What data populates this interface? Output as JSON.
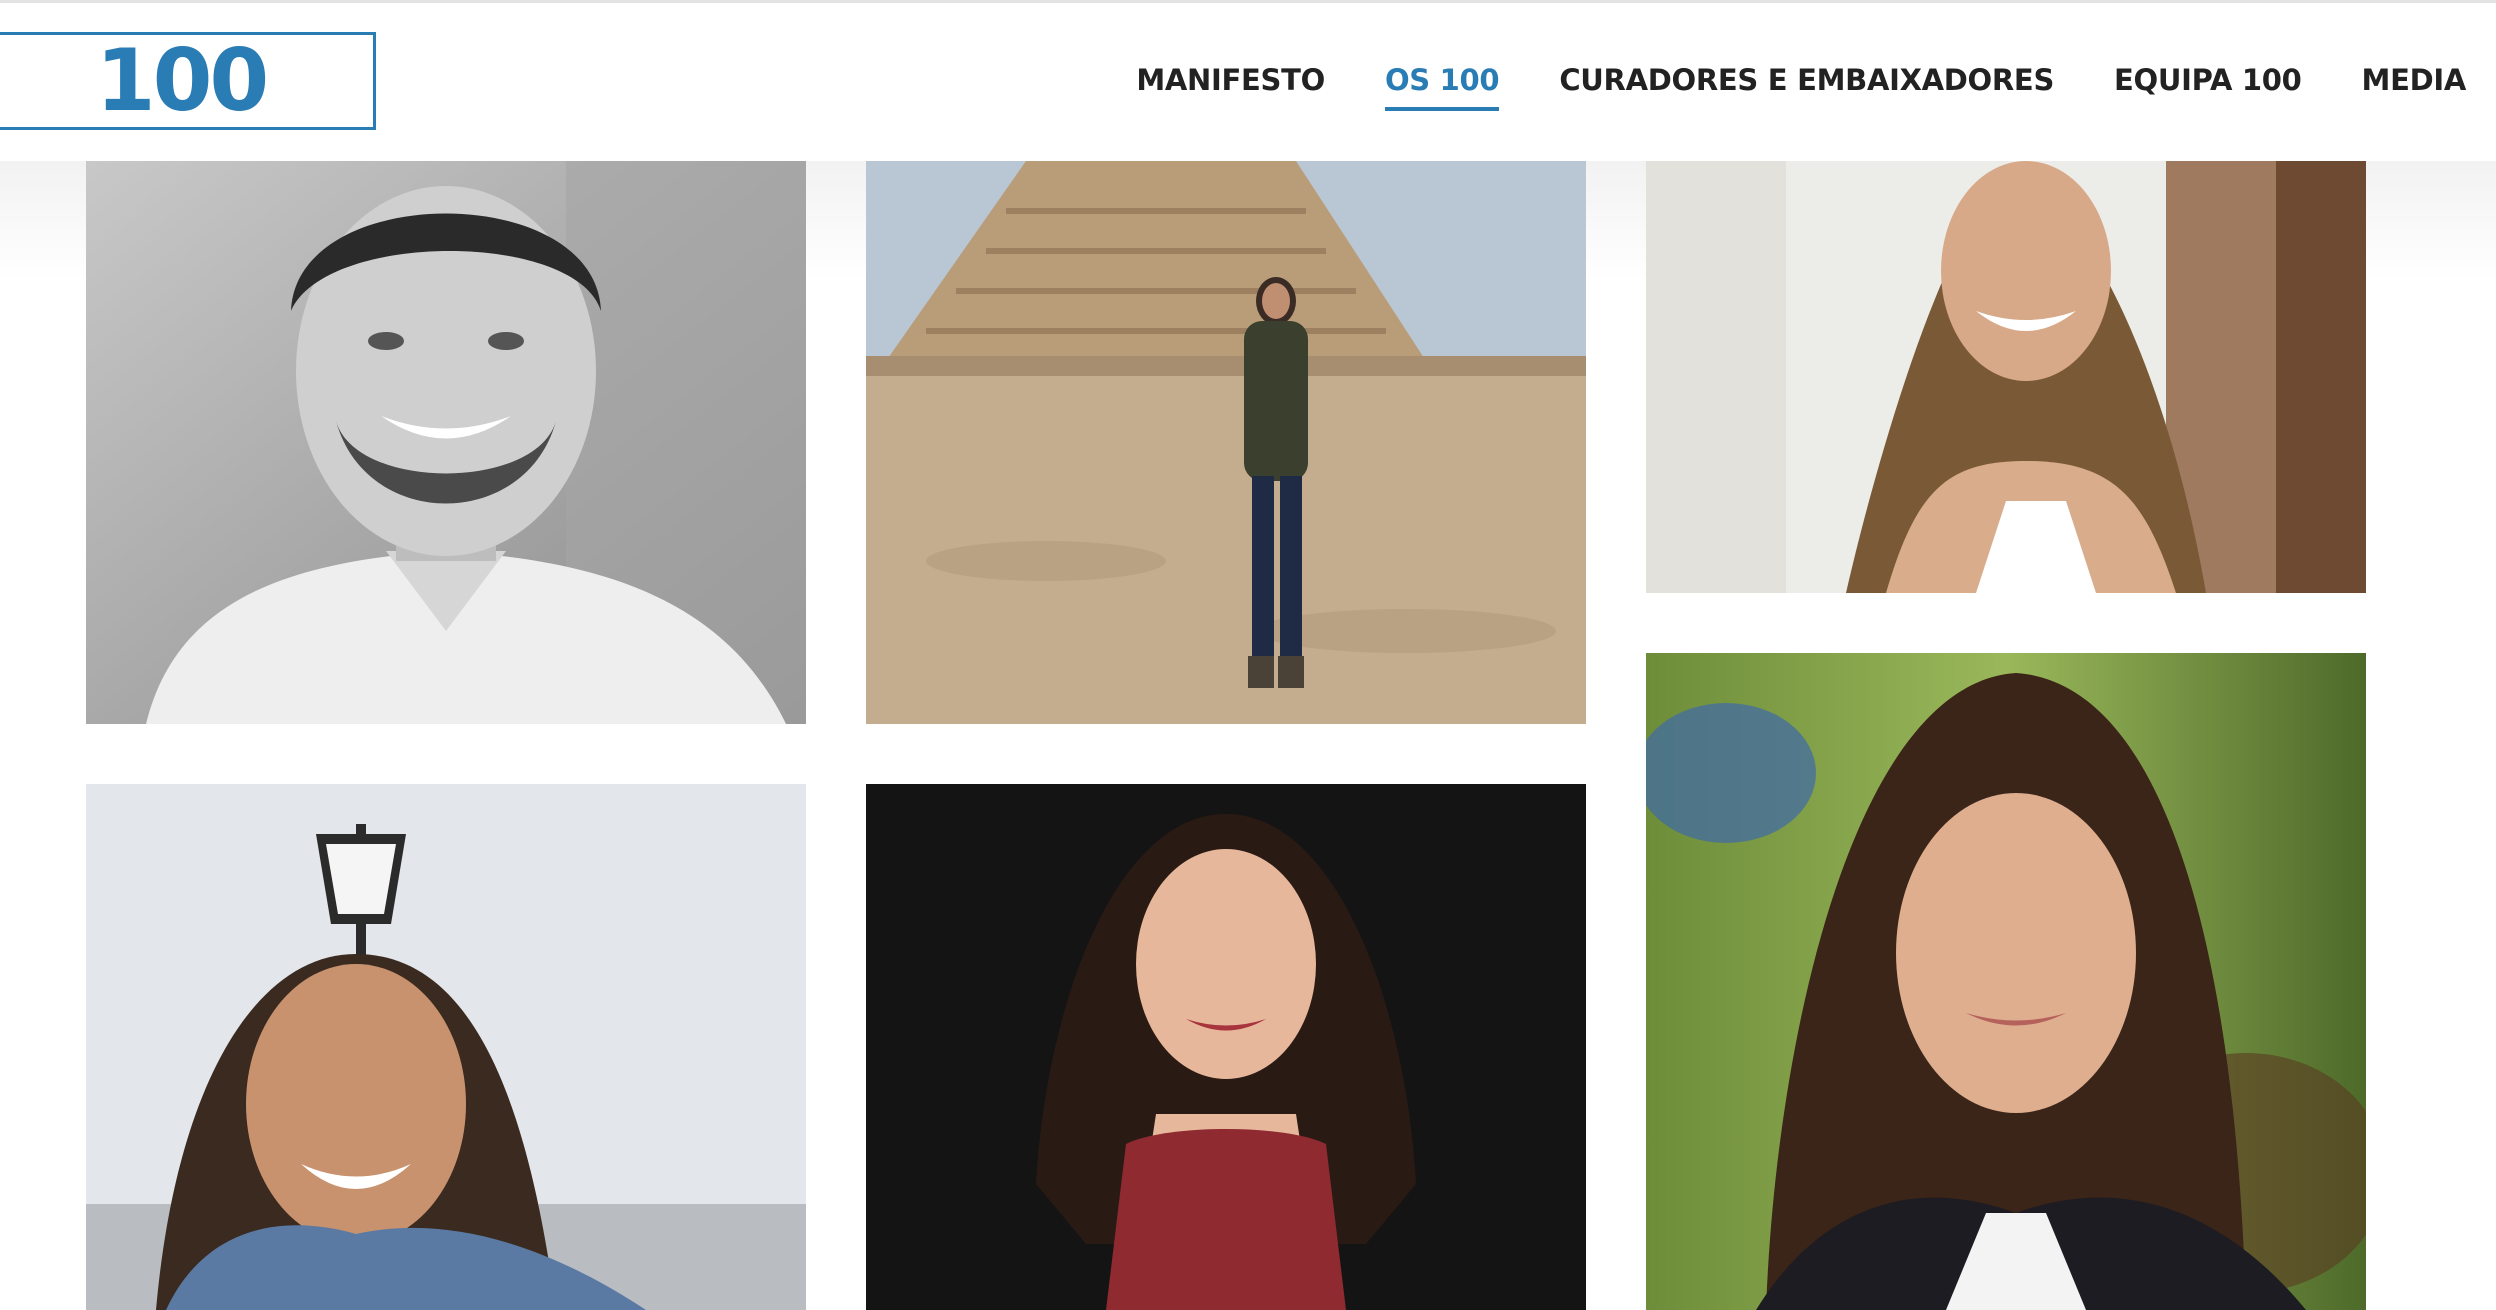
{
  "brand": {
    "logo_text": "100",
    "accent_color": "#2a7cb5"
  },
  "nav": {
    "items": [
      {
        "label": "MANIFESTO",
        "active": false
      },
      {
        "label": "OS 100",
        "active": true
      },
      {
        "label": "CURADORES E EMBAIXADORES",
        "active": false
      },
      {
        "label": "EQUIPA 100",
        "active": false
      },
      {
        "label": "MEDIA",
        "active": false
      }
    ]
  },
  "gallery": {
    "items": [
      {
        "photo": "man-bw-portrait-photo"
      },
      {
        "photo": "woman-at-pyramid-photo"
      },
      {
        "photo": "woman-smiling-long-hair-photo"
      },
      {
        "photo": "woman-denim-jacket-lamp-photo"
      },
      {
        "photo": "woman-red-dress-photo"
      },
      {
        "photo": "woman-outdoor-portrait-photo"
      }
    ]
  }
}
